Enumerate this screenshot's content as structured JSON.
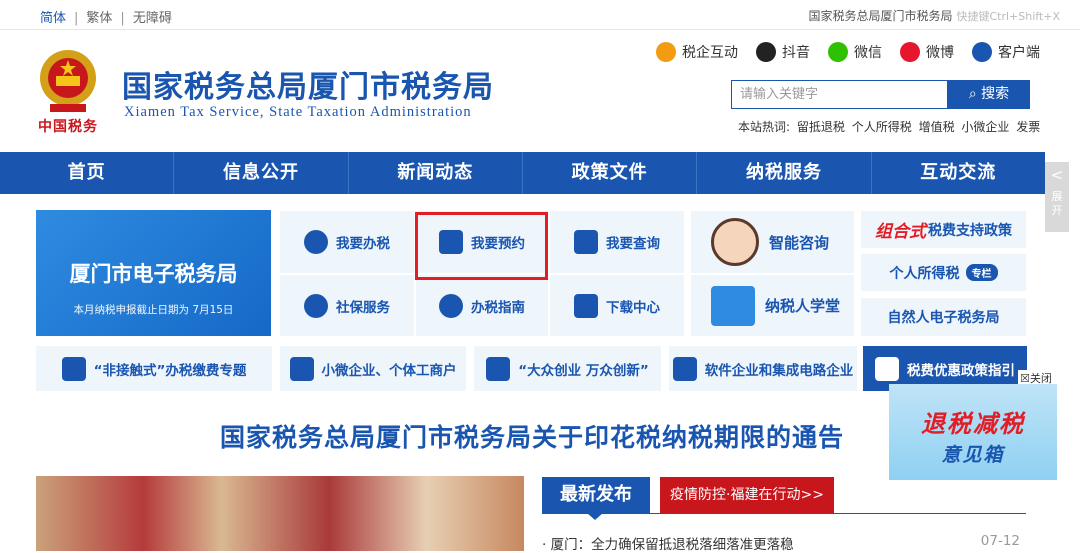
{
  "topbar": {
    "lang_simplified": "简体",
    "lang_traditional": "繁体",
    "accessibility": "无障碍",
    "right_text": "国家税务总局厦门市税务局",
    "hint": "快捷键Ctrl+Shift+X"
  },
  "header": {
    "brand_sub": "中国税务",
    "title": "国家税务总局厦门市税务局",
    "title_en": "Xiamen Tax Service, State Taxation Administration"
  },
  "social": [
    {
      "label": "税企互动",
      "color": "#f39c12"
    },
    {
      "label": "抖音",
      "color": "#222222"
    },
    {
      "label": "微信",
      "color": "#2dc100"
    },
    {
      "label": "微博",
      "color": "#e6162d"
    },
    {
      "label": "客户端",
      "color": "#1a56b0"
    }
  ],
  "search": {
    "placeholder": "请输入关键字",
    "button": "搜索",
    "hot_label": "本站热词:",
    "hot_words": [
      "留抵退税",
      "个人所得税",
      "增值税",
      "小微企业",
      "发票"
    ]
  },
  "nav": [
    "首页",
    "信息公开",
    "新闻动态",
    "政策文件",
    "纳税服务",
    "互动交流"
  ],
  "side_expand": {
    "arrow": "<",
    "label_1": "展",
    "label_2": "开"
  },
  "etax": {
    "title": "厦门市电子税务局",
    "subtitle": "本月纳税申报截止日期为 7月15日"
  },
  "services": {
    "handle": "我要办税",
    "appointment": "我要预约",
    "query": "我要查询",
    "social_security": "社保服务",
    "guide": "办税指南",
    "download": "下载中心"
  },
  "assist": {
    "smart_consult": "智能咨询",
    "school": "纳税人学堂"
  },
  "promos": {
    "combo_red": "组合式",
    "combo_rest": "税费支持政策",
    "iit": "个人所得税",
    "iit_tag": "专栏",
    "natural_person": "自然人电子税务局"
  },
  "row3": {
    "contactless": "“非接触式”办税缴费专题",
    "small_biz": "小微企业、个体工商户",
    "innovation": "“大众创业 万众创新”",
    "software": "软件企业和集成电路企业",
    "preferential": "税费优惠政策指引"
  },
  "float_ad": {
    "close": "☒关闭",
    "line1": "退税减税",
    "line2": "意见箱"
  },
  "notice": "国家税务总局厦门市税务局关于印花税纳税期限的通告",
  "news": {
    "tab_latest": "最新发布",
    "tab_epidemic": "疫情防控·福建在行动>>",
    "items": [
      {
        "title": "厦门：全力确保留抵退税落细落准更落稳",
        "date": "07-12"
      }
    ]
  }
}
